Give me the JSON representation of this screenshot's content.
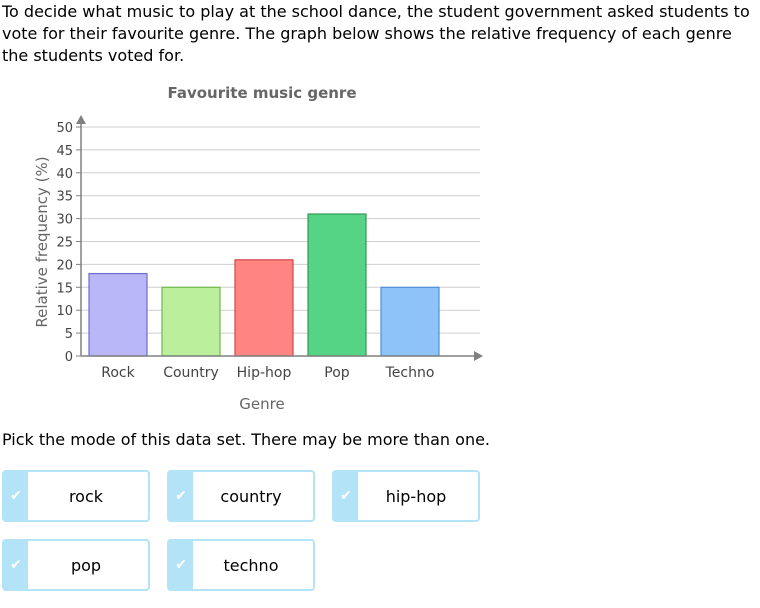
{
  "question": {
    "intro": "To decide what music to play at the school dance, the student government asked students to vote for their favourite genre. The graph below shows the relative frequency of each genre the students voted for.",
    "prompt": "Pick the mode of this data set. There may be more than one."
  },
  "chart_data": {
    "type": "bar",
    "title": "Favourite music genre",
    "xlabel": "Genre",
    "ylabel": "Relative frequency (%)",
    "categories": [
      "Rock",
      "Country",
      "Hip-hop",
      "Pop",
      "Techno"
    ],
    "values": [
      18,
      15,
      21,
      31,
      15
    ],
    "colors": [
      "#b9b7f7",
      "#bbef9b",
      "#ff8482",
      "#56d485",
      "#8ec3fa"
    ],
    "strokes": [
      "#6f6ccf",
      "#6fba4a",
      "#d2474a",
      "#2f9a52",
      "#4f8fd6"
    ],
    "ylim": [
      0,
      50
    ],
    "yticks": [
      0,
      5,
      10,
      15,
      20,
      25,
      30,
      35,
      40,
      45,
      50
    ],
    "grid": true,
    "legend": "none"
  },
  "options": [
    {
      "label": "rock"
    },
    {
      "label": "country"
    },
    {
      "label": "hip-hop"
    },
    {
      "label": "pop"
    },
    {
      "label": "techno"
    }
  ],
  "icons": {
    "check": "checkmark-icon"
  }
}
